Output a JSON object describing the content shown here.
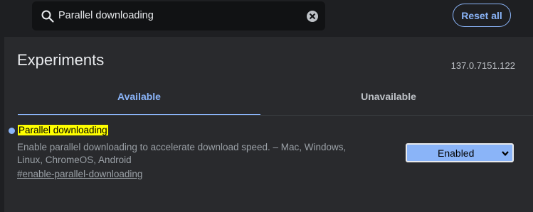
{
  "search": {
    "value": "Parallel downloading"
  },
  "toolbar": {
    "reset_label": "Reset all"
  },
  "page": {
    "title": "Experiments",
    "version": "137.0.7151.122"
  },
  "tabs": [
    {
      "label": "Available",
      "selected": true
    },
    {
      "label": "Unavailable",
      "selected": false
    }
  ],
  "experiment": {
    "title": "Parallel downloading",
    "description": "Enable parallel downloading to accelerate download speed. – Mac, Windows, Linux, ChromeOS, Android",
    "link": "#enable-parallel-downloading",
    "selected_value": "Enabled"
  },
  "colors": {
    "accent": "#8ab4f8",
    "highlight": "#ffff00",
    "panel": "#292a2d",
    "background": "#1e1f22"
  }
}
